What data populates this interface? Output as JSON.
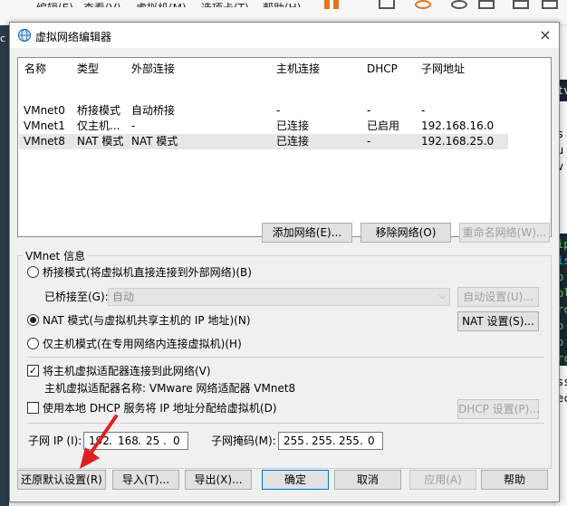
{
  "background_app": {
    "menu": [
      "编辑(E)",
      "查看(V)",
      "虚拟机(M)",
      "选项卡(T)",
      "帮助(H)"
    ],
    "left_strip_char": "c",
    "right_strip_lines": [
      "tv",
      "s",
      "u",
      "v",
      "ip",
      "is",
      "p",
      "pl",
      "rc",
      "o",
      "p",
      "rc",
      "ss",
      "ec"
    ]
  },
  "dialog": {
    "title": "虚拟网络编辑器",
    "close_glyph": "×",
    "table": {
      "headers": [
        "名称",
        "类型",
        "外部连接",
        "主机连接",
        "DHCP",
        "子网地址"
      ],
      "rows": [
        {
          "name": "VMnet0",
          "type": "桥接模式",
          "external": "自动桥接",
          "host": "-",
          "dhcp": "-",
          "subnet": "-"
        },
        {
          "name": "VMnet1",
          "type": "仅主机...",
          "external": "-",
          "host": "已连接",
          "dhcp": "已启用",
          "subnet": "192.168.16.0"
        },
        {
          "name": "VMnet8",
          "type": "NAT 模式",
          "external": "NAT 模式",
          "host": "已连接",
          "dhcp": "-",
          "subnet": "192.168.25.0"
        }
      ],
      "selected_row": 2
    },
    "table_buttons": {
      "add": "添加网络(E)...",
      "remove": "移除网络(O)",
      "rename": "重命名网络(W)..."
    },
    "vmnet_info": {
      "group_label": "VMnet 信息",
      "bridged_radio": "桥接模式(将虚拟机直接连接到外部网络)(B)",
      "bridged_to_label": "已桥接至(G):",
      "bridged_to_value": "自动",
      "auto_settings": "自动设置(U)...",
      "nat_radio": "NAT 模式(与虚拟机共享主机的 IP 地址)(N)",
      "nat_settings": "NAT 设置(S)...",
      "hostonly_radio": "仅主机模式(在专用网络内连接虚拟机)(H)",
      "selected_mode": "nat",
      "connect_adapter_check": "将主机虚拟适配器连接到此网络(V)",
      "connect_adapter_checked": true,
      "adapter_name_line": "主机虚拟适配器名称: VMware 网络适配器 VMnet8",
      "dhcp_check": "使用本地 DHCP 服务将 IP 地址分配给虚拟机(D)",
      "dhcp_checked": false,
      "dhcp_settings": "DHCP 设置(P)...",
      "subnet_ip_label": "子网 IP (I):",
      "subnet_ip": [
        "192",
        "168",
        "25",
        "0"
      ],
      "subnet_mask_label": "子网掩码(M):",
      "subnet_mask": [
        "255",
        "255",
        "255",
        "0"
      ]
    },
    "footer": {
      "restore": "还原默认设置(R)",
      "import": "导入(T)...",
      "export": "导出(X)...",
      "ok": "确定",
      "cancel": "取消",
      "apply": "应用(A)",
      "help": "帮助"
    }
  },
  "colors": {
    "dialog_bg": "#f0f0f0",
    "selected_row": "#e7e7e7",
    "annotation_arrow": "#e02020",
    "focus_blue": "#0078d7"
  }
}
